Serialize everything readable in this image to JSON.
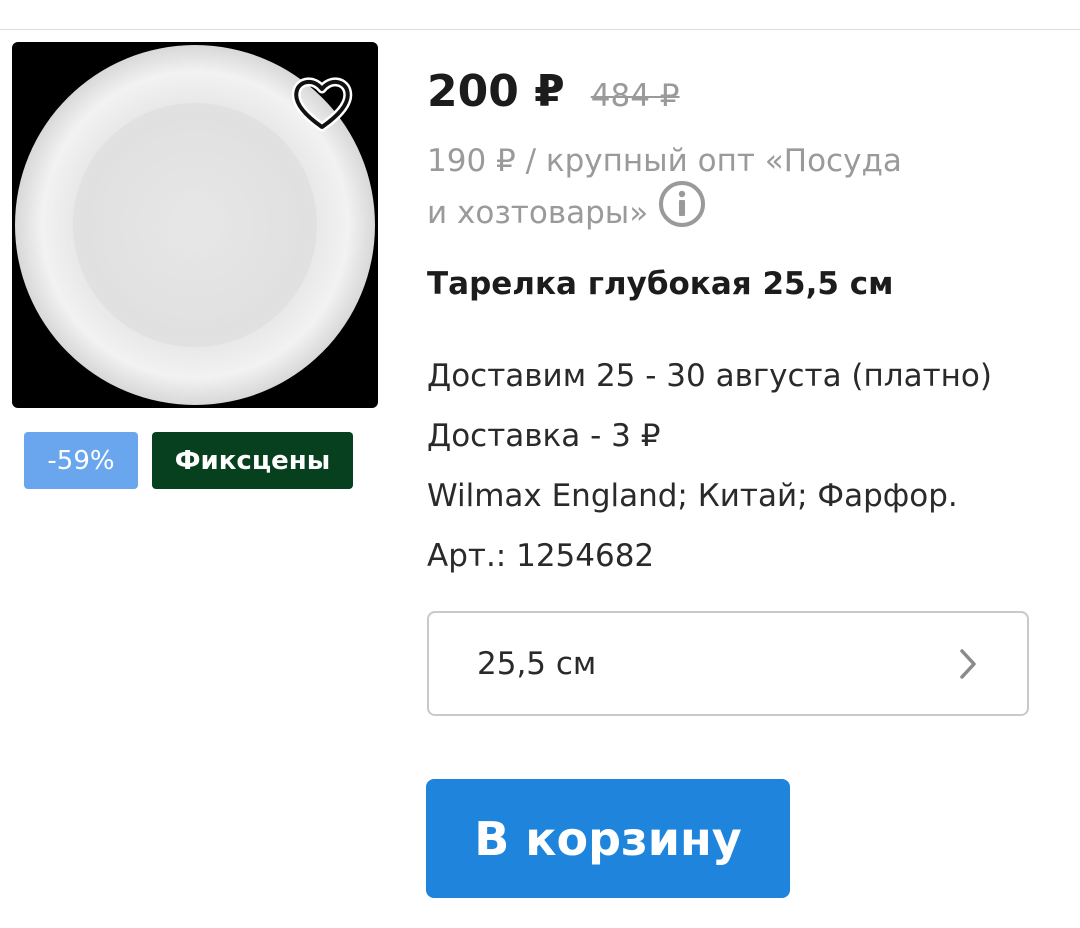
{
  "product": {
    "price_current": "200 ₽",
    "price_old": "484 ₽",
    "wholesale_line1": "190 ₽ / крупный опт «Посуда",
    "wholesale_line2": "и хозтовары»",
    "title": "Тарелка глубокая 25,5 см",
    "delivery_date": "Доставим 25 - 30 августа (платно)",
    "delivery_cost": "Доставка - 3 ₽",
    "brand_info": "Wilmax England; Китай; Фарфор.",
    "article": "Арт.: 1254682"
  },
  "badges": {
    "discount": "-59%",
    "fixed_price": "Фиксцены"
  },
  "size_select": {
    "value": "25,5 см"
  },
  "cart_button": {
    "label": "В корзину"
  },
  "icons": {
    "favorite": "heart-icon",
    "info": "info-icon",
    "chevron": "chevron-right-icon"
  },
  "colors": {
    "cart_button": "#1e84dc",
    "discount_badge": "#6aa6ee",
    "fixed_price_badge": "#07401f",
    "muted_text": "#9a9a9a"
  }
}
